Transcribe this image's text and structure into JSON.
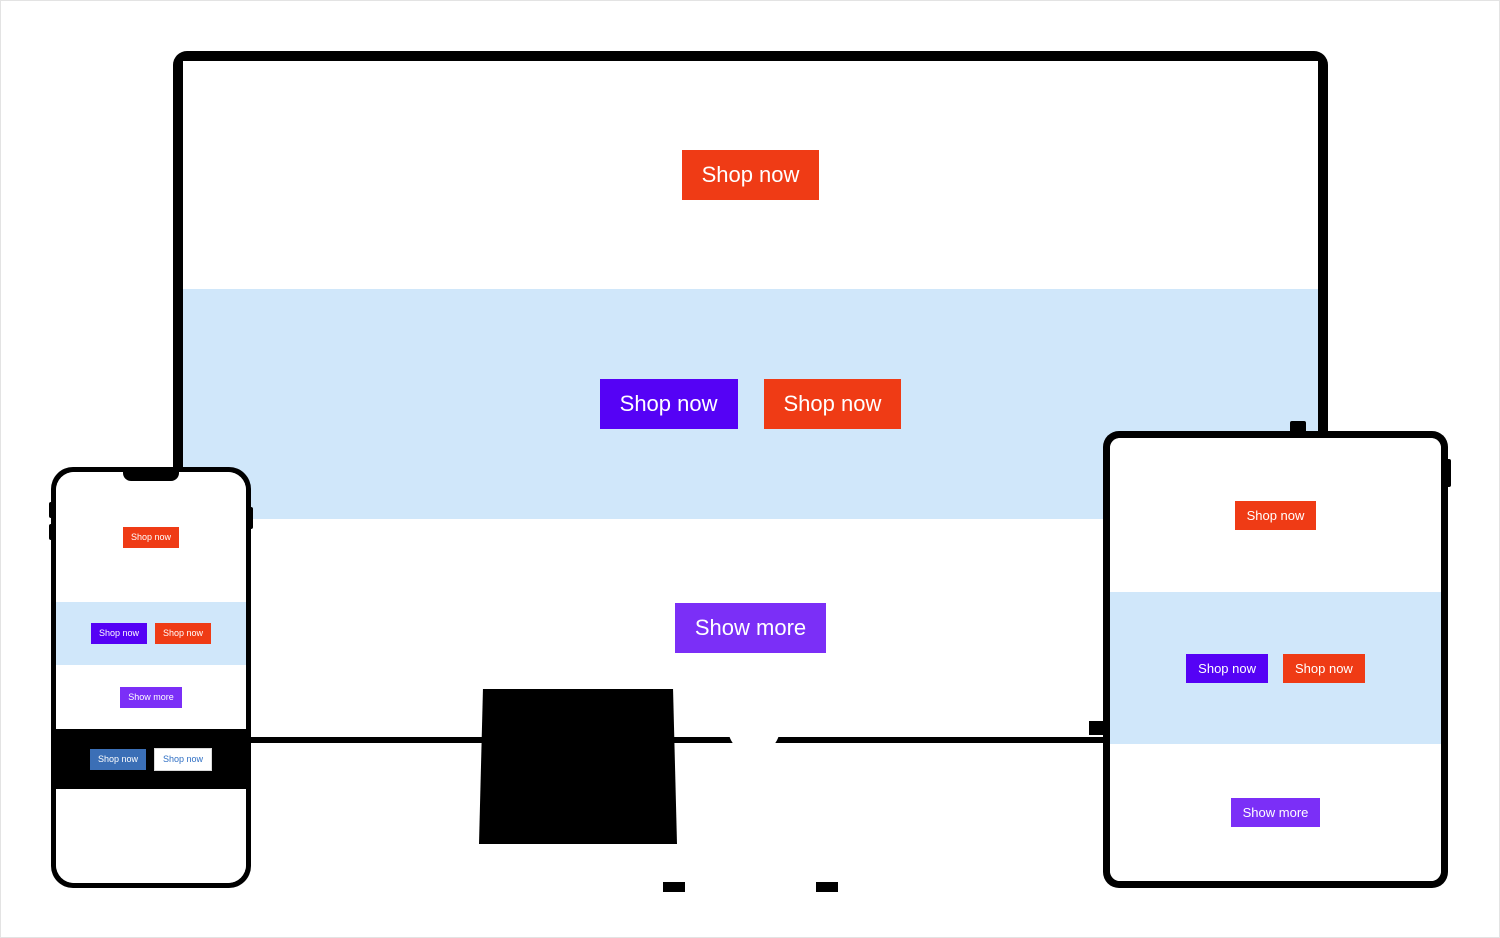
{
  "page": {
    "title": "Responsive button showcase across desktop, phone and tablet mockups",
    "background_color": "#ffffff",
    "border_color": "#e3e3e3"
  },
  "colors": {
    "red": "#ef3b15",
    "purple": "#5502f5",
    "violet": "#7b2ff7",
    "steel_blue": "#3b6fb6",
    "white_button_text": "#2f6fc4",
    "light_blue_band": "#d0e7fa",
    "black_band": "#000000",
    "frame": "#000000"
  },
  "labels": {
    "shop_now": "Shop now",
    "show_more": "Show more"
  },
  "devices": {
    "desktop": {
      "name": "Desktop monitor",
      "sections": [
        {
          "id": "desktop-section-1",
          "background": "#ffffff",
          "buttons": [
            {
              "label": "Shop now",
              "style": "red"
            }
          ]
        },
        {
          "id": "desktop-section-2",
          "background": "#d0e7fa",
          "buttons": [
            {
              "label": "Shop now",
              "style": "purple"
            },
            {
              "label": "Shop now",
              "style": "red"
            }
          ]
        },
        {
          "id": "desktop-section-3",
          "background": "#ffffff",
          "buttons": [
            {
              "label": "Show more",
              "style": "violet"
            }
          ]
        }
      ]
    },
    "phone": {
      "name": "Mobile phone",
      "sections": [
        {
          "id": "phone-section-1",
          "background": "#ffffff",
          "buttons": [
            {
              "label": "Shop now",
              "style": "red"
            }
          ]
        },
        {
          "id": "phone-section-2",
          "background": "#d0e7fa",
          "buttons": [
            {
              "label": "Shop now",
              "style": "purple"
            },
            {
              "label": "Shop now",
              "style": "red"
            }
          ]
        },
        {
          "id": "phone-section-3",
          "background": "#ffffff",
          "buttons": [
            {
              "label": "Show more",
              "style": "violet"
            }
          ]
        },
        {
          "id": "phone-section-4",
          "background": "#000000",
          "buttons": [
            {
              "label": "Shop now",
              "style": "steel"
            },
            {
              "label": "Shop now",
              "style": "white"
            }
          ]
        },
        {
          "id": "phone-section-5",
          "background": "#ffffff",
          "buttons": []
        }
      ]
    },
    "tablet": {
      "name": "Tablet",
      "sections": [
        {
          "id": "tablet-section-1",
          "background": "#ffffff",
          "buttons": [
            {
              "label": "Shop now",
              "style": "red"
            }
          ]
        },
        {
          "id": "tablet-section-2",
          "background": "#d0e7fa",
          "buttons": [
            {
              "label": "Shop now",
              "style": "purple"
            },
            {
              "label": "Shop now",
              "style": "red"
            }
          ]
        },
        {
          "id": "tablet-section-3",
          "background": "#ffffff",
          "buttons": [
            {
              "label": "Show more",
              "style": "violet"
            }
          ]
        }
      ]
    }
  }
}
